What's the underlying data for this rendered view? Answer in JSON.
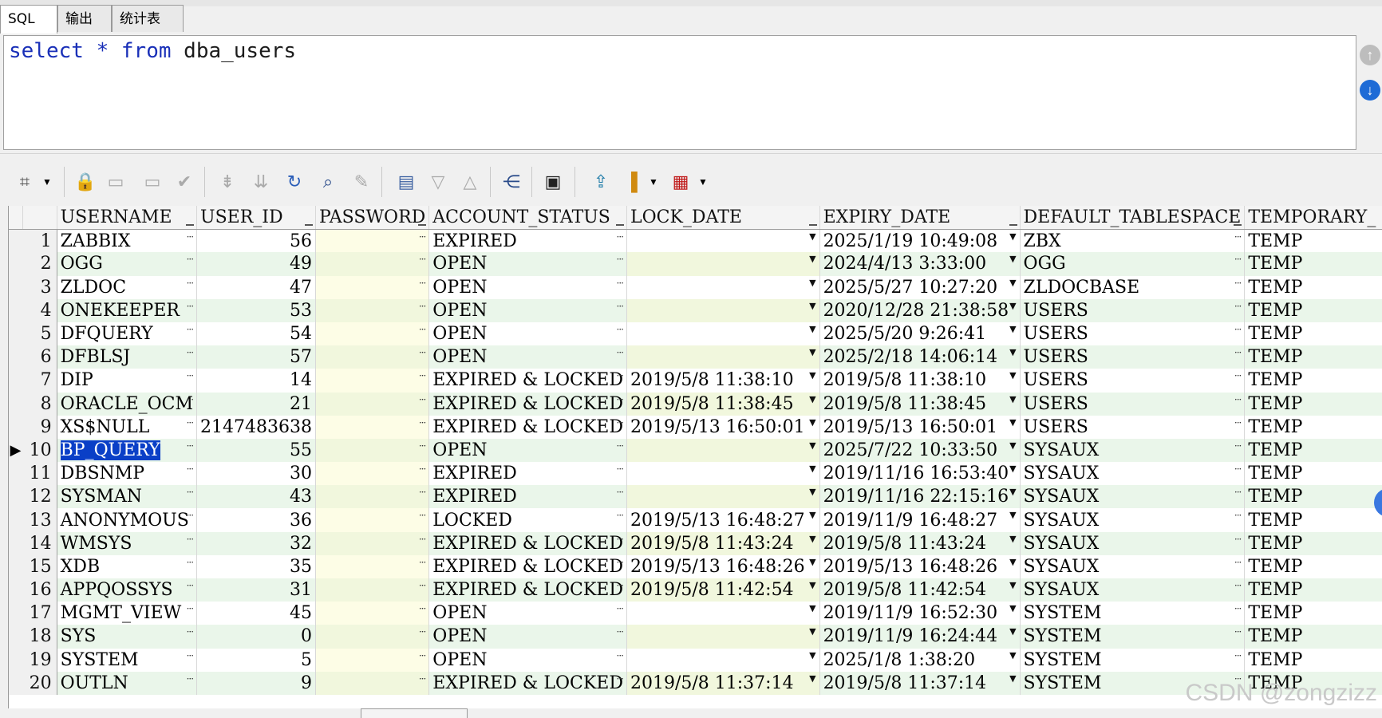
{
  "tabs": [
    {
      "label": "SQL",
      "active": true
    },
    {
      "label": "输出",
      "active": false
    },
    {
      "label": "统计表",
      "active": false
    }
  ],
  "editor": {
    "tokens": [
      {
        "text": "select",
        "kind": "kw"
      },
      {
        "text": " ",
        "kind": "id"
      },
      {
        "text": "*",
        "kind": "op"
      },
      {
        "text": " ",
        "kind": "id"
      },
      {
        "text": "from",
        "kind": "kw"
      },
      {
        "text": " dba_users",
        "kind": "id"
      }
    ]
  },
  "toolbar": {
    "icons": [
      "grid-options-icon",
      "dropdown-arrow-icon",
      "lock-icon",
      "insert-record-icon",
      "delete-record-icon",
      "post-changes-icon",
      "fetch-next-page-icon",
      "fetch-all-icon",
      "refresh-icon",
      "find-icon",
      "clear-icon",
      "single-record-view-icon",
      "filter-down-icon",
      "filter-up-icon",
      "query-by-example-icon",
      "save-icon",
      "export-icon",
      "chart-icon",
      "chart-dropdown-icon",
      "table-view-icon",
      "table-dropdown-icon"
    ]
  },
  "grid": {
    "columns": [
      "USERNAME",
      "USER_ID",
      "PASSWORD",
      "ACCOUNT_STATUS",
      "LOCK_DATE",
      "EXPIRY_DATE",
      "DEFAULT_TABLESPACE",
      "TEMPORARY_"
    ],
    "selected_row": 10,
    "rows": [
      {
        "n": "1",
        "username": "ZABBIX",
        "user_id": "56",
        "password": "",
        "status": "EXPIRED",
        "lock_date": "",
        "expiry_date": "2025/1/19 10:49:08",
        "default_ts": "ZBX",
        "temp_ts": "TEMP"
      },
      {
        "n": "2",
        "username": "OGG",
        "user_id": "49",
        "password": "",
        "status": "OPEN",
        "lock_date": "",
        "expiry_date": "2024/4/13 3:33:00",
        "default_ts": "OGG",
        "temp_ts": "TEMP"
      },
      {
        "n": "3",
        "username": "ZLDOC",
        "user_id": "47",
        "password": "",
        "status": "OPEN",
        "lock_date": "",
        "expiry_date": "2025/5/27 10:27:20",
        "default_ts": "ZLDOCBASE",
        "temp_ts": "TEMP"
      },
      {
        "n": "4",
        "username": "ONEKEEPER",
        "user_id": "53",
        "password": "",
        "status": "OPEN",
        "lock_date": "",
        "expiry_date": "2020/12/28 21:38:58",
        "default_ts": "USERS",
        "temp_ts": "TEMP"
      },
      {
        "n": "5",
        "username": "DFQUERY",
        "user_id": "54",
        "password": "",
        "status": "OPEN",
        "lock_date": "",
        "expiry_date": "2025/5/20 9:26:41",
        "default_ts": "USERS",
        "temp_ts": "TEMP"
      },
      {
        "n": "6",
        "username": "DFBLSJ",
        "user_id": "57",
        "password": "",
        "status": "OPEN",
        "lock_date": "",
        "expiry_date": "2025/2/18 14:06:14",
        "default_ts": "USERS",
        "temp_ts": "TEMP"
      },
      {
        "n": "7",
        "username": "DIP",
        "user_id": "14",
        "password": "",
        "status": "EXPIRED & LOCKED",
        "lock_date": "2019/5/8 11:38:10",
        "expiry_date": "2019/5/8 11:38:10",
        "default_ts": "USERS",
        "temp_ts": "TEMP"
      },
      {
        "n": "8",
        "username": "ORACLE_OCM",
        "user_id": "21",
        "password": "",
        "status": "EXPIRED & LOCKED",
        "lock_date": "2019/5/8 11:38:45",
        "expiry_date": "2019/5/8 11:38:45",
        "default_ts": "USERS",
        "temp_ts": "TEMP"
      },
      {
        "n": "9",
        "username": "XS$NULL",
        "user_id": "2147483638",
        "password": "",
        "status": "EXPIRED & LOCKED",
        "lock_date": "2019/5/13 16:50:01",
        "expiry_date": "2019/5/13 16:50:01",
        "default_ts": "USERS",
        "temp_ts": "TEMP"
      },
      {
        "n": "10",
        "username": "BP_QUERY",
        "user_id": "55",
        "password": "",
        "status": "OPEN",
        "lock_date": "",
        "expiry_date": "2025/7/22 10:33:50",
        "default_ts": "SYSAUX",
        "temp_ts": "TEMP"
      },
      {
        "n": "11",
        "username": "DBSNMP",
        "user_id": "30",
        "password": "",
        "status": "EXPIRED",
        "lock_date": "",
        "expiry_date": "2019/11/16 16:53:40",
        "default_ts": "SYSAUX",
        "temp_ts": "TEMP"
      },
      {
        "n": "12",
        "username": "SYSMAN",
        "user_id": "43",
        "password": "",
        "status": "EXPIRED",
        "lock_date": "",
        "expiry_date": "2019/11/16 22:15:16",
        "default_ts": "SYSAUX",
        "temp_ts": "TEMP"
      },
      {
        "n": "13",
        "username": "ANONYMOUS",
        "user_id": "36",
        "password": "",
        "status": "LOCKED",
        "lock_date": "2019/5/13 16:48:27",
        "expiry_date": "2019/11/9 16:48:27",
        "default_ts": "SYSAUX",
        "temp_ts": "TEMP"
      },
      {
        "n": "14",
        "username": "WMSYS",
        "user_id": "32",
        "password": "",
        "status": "EXPIRED & LOCKED",
        "lock_date": "2019/5/8 11:43:24",
        "expiry_date": "2019/5/8 11:43:24",
        "default_ts": "SYSAUX",
        "temp_ts": "TEMP"
      },
      {
        "n": "15",
        "username": "XDB",
        "user_id": "35",
        "password": "",
        "status": "EXPIRED & LOCKED",
        "lock_date": "2019/5/13 16:48:26",
        "expiry_date": "2019/5/13 16:48:26",
        "default_ts": "SYSAUX",
        "temp_ts": "TEMP"
      },
      {
        "n": "16",
        "username": "APPQOSSYS",
        "user_id": "31",
        "password": "",
        "status": "EXPIRED & LOCKED",
        "lock_date": "2019/5/8 11:42:54",
        "expiry_date": "2019/5/8 11:42:54",
        "default_ts": "SYSAUX",
        "temp_ts": "TEMP"
      },
      {
        "n": "17",
        "username": "MGMT_VIEW",
        "user_id": "45",
        "password": "",
        "status": "OPEN",
        "lock_date": "",
        "expiry_date": "2019/11/9 16:52:30",
        "default_ts": "SYSTEM",
        "temp_ts": "TEMP"
      },
      {
        "n": "18",
        "username": "SYS",
        "user_id": "0",
        "password": "",
        "status": "OPEN",
        "lock_date": "",
        "expiry_date": "2019/11/9 16:24:44",
        "default_ts": "SYSTEM",
        "temp_ts": "TEMP"
      },
      {
        "n": "19",
        "username": "SYSTEM",
        "user_id": "5",
        "password": "",
        "status": "OPEN",
        "lock_date": "",
        "expiry_date": "2025/1/8 1:38:20",
        "default_ts": "SYSTEM",
        "temp_ts": "TEMP"
      },
      {
        "n": "20",
        "username": "OUTLN",
        "user_id": "9",
        "password": "",
        "status": "EXPIRED & LOCKED",
        "lock_date": "2019/5/8 11:37:14",
        "expiry_date": "2019/5/8 11:37:14",
        "default_ts": "SYSTEM",
        "temp_ts": "TEMP"
      }
    ]
  },
  "watermark": "CSDN @zongzizz",
  "colors": {
    "keyword": "#1a30b8",
    "selection": "#0a3fc7",
    "row_alt": "#eaf6ea"
  }
}
